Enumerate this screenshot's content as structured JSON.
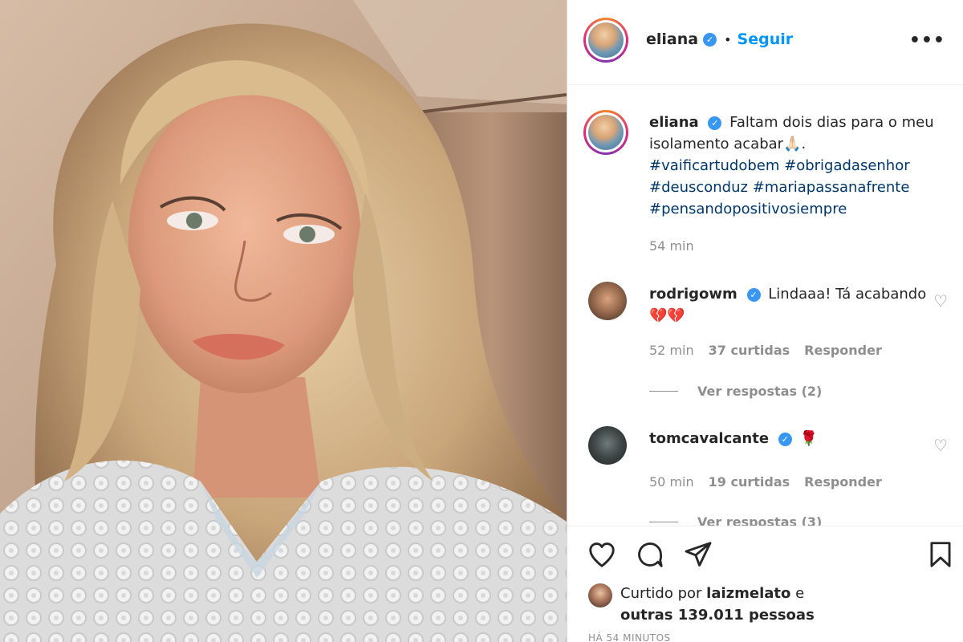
{
  "post": {
    "username": "eliana",
    "follow_label": "Seguir",
    "separator": "•",
    "caption_text": "Faltam dois dias para o meu isolamento acabar🙏🏻.",
    "hashtags": [
      "#vaificartudobem",
      "#obrigadasenhor",
      "#deusconduz",
      "#mariapassanafrente",
      "#pensandopositivosiempre"
    ],
    "caption_time": "54 min"
  },
  "comments": [
    {
      "username": "rodrigowm",
      "text": "Lindaaa! Tá acabando 💔💔",
      "time": "52 min",
      "likes": "37 curtidas",
      "reply_label": "Responder",
      "view_replies": "Ver respostas (2)"
    },
    {
      "username": "tomcavalcante",
      "text": "🌹",
      "time": "50 min",
      "likes": "19 curtidas",
      "reply_label": "Responder",
      "view_replies": "Ver respostas (3)"
    }
  ],
  "footer": {
    "liked_by_prefix": "Curtido por",
    "liked_by_user": "laizmelato",
    "liked_by_suffix": "e",
    "others": "outras 139.011 pessoas",
    "timestamp": "HÁ 54 MINUTOS"
  },
  "icons": {
    "verified": "verified-badge-icon",
    "more": "more-options-icon",
    "heart": "heart-icon",
    "comment": "comment-icon",
    "share": "share-icon",
    "save": "save-icon"
  },
  "colors": {
    "accent": "#0095f6",
    "hashtag": "#00376b",
    "muted": "#8e8e8e",
    "verified": "#3897f0"
  }
}
